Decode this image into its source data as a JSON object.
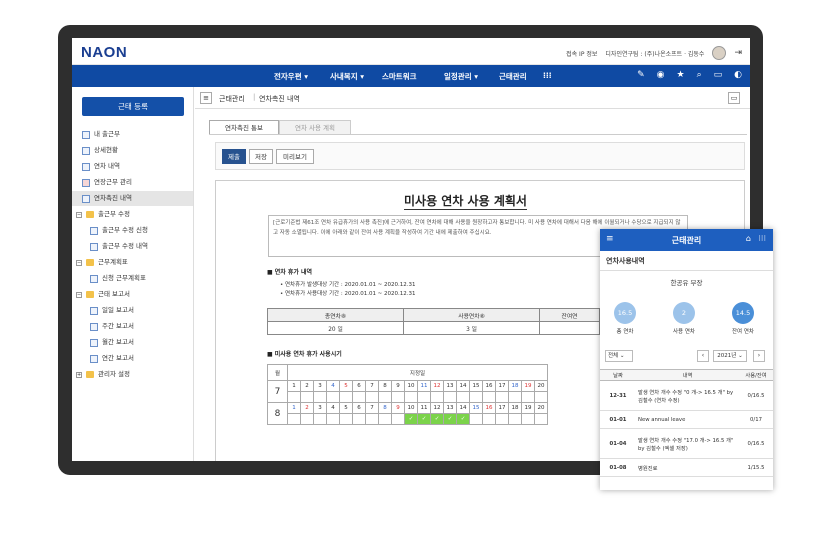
{
  "topbar": {
    "logo": "NAON",
    "info": "접속 IP 정보",
    "org": "디자인연구팀 : (주)나온소프트 · 김동수"
  },
  "nav": {
    "items": [
      "전자우편",
      "사내복지",
      "스마트워크",
      "일정관리",
      "근태관리"
    ]
  },
  "sidebar": {
    "button": "근태 등록",
    "items": [
      "내 출근부",
      "상세현황",
      "연차 내역",
      "연장근무 관리",
      "연차촉진 내역",
      "출근부 수정",
      "출근부 수정 신청",
      "출근부 수정 내역",
      "근무계획표",
      "신청 근무계획표",
      "근태 보고서",
      "일일 보고서",
      "주간 보고서",
      "월간 보고서",
      "연간 보고서",
      "관리자 설정"
    ]
  },
  "breadcrumb": {
    "first": "근태관리",
    "second": "연차촉진 내역"
  },
  "tabs": [
    "연차촉진 통보",
    "연차 사용 계획"
  ],
  "buttons": [
    "제출",
    "저장",
    "미리보기"
  ],
  "doc": {
    "title": "미사용 연차 사용 계획서",
    "note": "[근로기준법 제61조 연차 유급휴가의 사용 촉진]에 근거하여, 잔여 연차에 대해 사용을 원장하고자 통보합니다. 미 사용 연차에 대해서 다음 해에 이월되거나 수당으로 지급되지 않고 자동 소멸됩니다. 이에 아래와 같이 잔여 사용 계획을 작성하여 기간 내에 제출하여 주십시요.",
    "sect1": "■ 연차 휴가 내역",
    "period1": "연차휴가 발생대상 기간 : 2020.01.01 ~ 2020.12.31",
    "period2": "연차휴가 사용대상 기간 : 2020.01.01 ~ 2020.12.31",
    "tbl_headers": [
      "총연차⑧",
      "사용연차⑧",
      "잔여연"
    ],
    "tbl_values": [
      "20 일",
      "3 일",
      ""
    ],
    "sect2": "■ 미사용 연차 휴가 사용시기",
    "cal_month_label": "월",
    "cal_day_label": "지정일",
    "months": [
      "7",
      "8"
    ]
  },
  "mobile": {
    "title": "근태관리",
    "section": "연차사용내역",
    "name": "한공유 부장",
    "total": "16.5",
    "total_label": "총 연차",
    "used": "2",
    "used_label": "사용 연차",
    "remain": "14.5",
    "remain_label": "잔여 연차",
    "filter": "전체",
    "year": "2021년",
    "headers": [
      "날짜",
      "내역",
      "사용/잔여"
    ],
    "rows": [
      {
        "date": "12-31",
        "desc": "발생 연차 개수 수정 \"0 개-> 16.5 개\" by 김철수 (연차 수정)",
        "val": "0/16.5"
      },
      {
        "date": "01-01",
        "desc": "New annual leave",
        "val": "0/17"
      },
      {
        "date": "01-04",
        "desc": "발생 연차 개수 수정 \"17.0 개-> 16.5 개\" by 김철수 (엑셀 저장)",
        "val": "0/16.5"
      },
      {
        "date": "01-08",
        "desc": "병원진료",
        "val": "1/15.5"
      }
    ]
  },
  "colors": {
    "nav": "#0f4aa3",
    "mobile_bar": "#1e5fbf",
    "circle_light": "#9cc3ea",
    "circle_dark": "#4a8fd8",
    "check": "#7bd34a"
  }
}
